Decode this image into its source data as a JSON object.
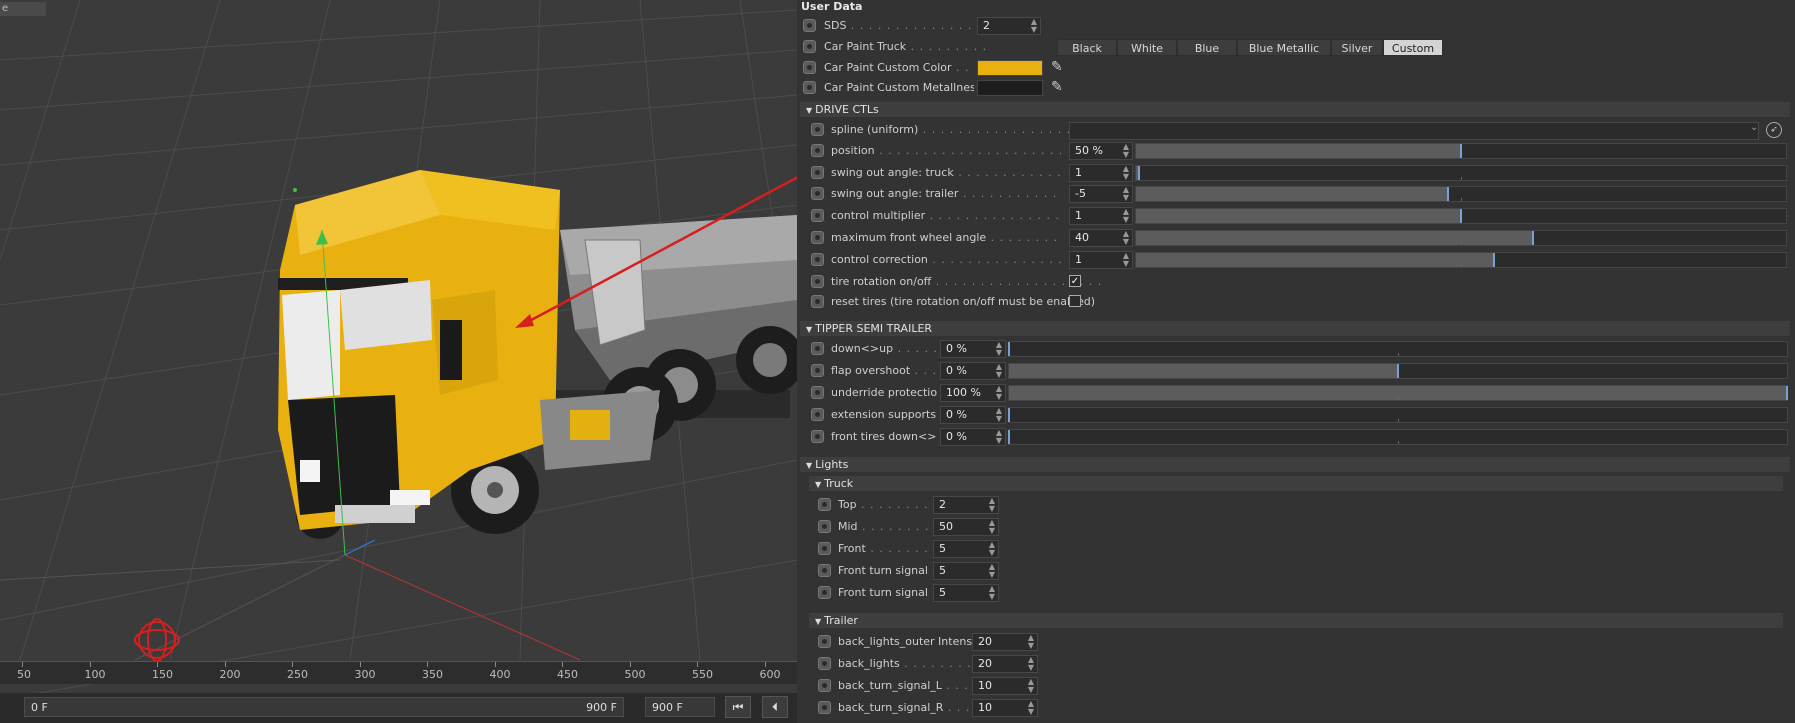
{
  "viewport": {
    "tab_label": "e",
    "timeline_ticks": [
      "50",
      "100",
      "150",
      "200",
      "250",
      "300",
      "350",
      "400",
      "450",
      "500",
      "550",
      "600"
    ],
    "frame_start": "0 F",
    "frame_end": "900 F",
    "frame_total": "900 F",
    "colors": {
      "truck_paint": "#e8b10f",
      "trailer": "#8a8a8a",
      "arrow": "#d61f1f"
    }
  },
  "panel": {
    "title": "User Data",
    "sds": {
      "label": "SDS",
      "value": "2"
    },
    "car_paint_truck": {
      "label": "Car Paint Truck",
      "options": [
        "Black",
        "White",
        "Blue",
        "Blue Metallic",
        "Silver",
        "Custom"
      ],
      "selected": "Custom"
    },
    "custom_color": {
      "label": "Car Paint Custom Color",
      "color": "#e8b10f"
    },
    "custom_metalness": {
      "label": "Car Paint Custom Metallness",
      "color": "#1e1e1e"
    },
    "drive": {
      "title": "DRIVE CTLs",
      "spline_label": "spline (uniform)",
      "rows": [
        {
          "label": "position",
          "value": "50 %",
          "level": 0.5
        },
        {
          "label": "swing out angle: truck",
          "value": "1",
          "level": 0.005
        },
        {
          "label": "swing out angle: trailer",
          "value": "-5",
          "level": 0.48
        },
        {
          "label": "control multiplier",
          "value": "1",
          "level": 0.5
        },
        {
          "label": "maximum front wheel angle",
          "value": "40",
          "level": 0.61
        },
        {
          "label": "control correction",
          "value": "1",
          "level": 0.55
        }
      ],
      "tire_rotation": {
        "label": "tire rotation on/off",
        "checked": true
      },
      "reset_tires": {
        "label": "reset tires (tire rotation on/off must be enabled)",
        "checked": false
      }
    },
    "tipper": {
      "title": "TIPPER SEMI TRAILER",
      "rows": [
        {
          "label": "down<>up",
          "value": "0 %",
          "level": 0
        },
        {
          "label": "flap overshoot",
          "value": "0 %",
          "level": 0.5
        },
        {
          "label": "underride protection",
          "value": "100 %",
          "level": 1
        },
        {
          "label": "extension supports",
          "value": "0 %",
          "level": 0
        },
        {
          "label": "front tires down<>up",
          "value": "0 %",
          "level": 0
        }
      ]
    },
    "lights": {
      "title": "Lights",
      "truck": {
        "title": "Truck",
        "rows": [
          {
            "label": "Top",
            "value": "2"
          },
          {
            "label": "Mid",
            "value": "50"
          },
          {
            "label": "Front",
            "value": "5"
          },
          {
            "label": "Front turn signal L",
            "value": "5"
          },
          {
            "label": "Front turn signal R",
            "value": "5"
          }
        ]
      },
      "trailer": {
        "title": "Trailer",
        "rows": [
          {
            "label": "back_lights_outer Intensity",
            "value": "20"
          },
          {
            "label": "back_lights",
            "value": "20"
          },
          {
            "label": "back_turn_signal_L",
            "value": "10"
          },
          {
            "label": "back_turn_signal_R",
            "value": "10"
          }
        ]
      }
    }
  }
}
